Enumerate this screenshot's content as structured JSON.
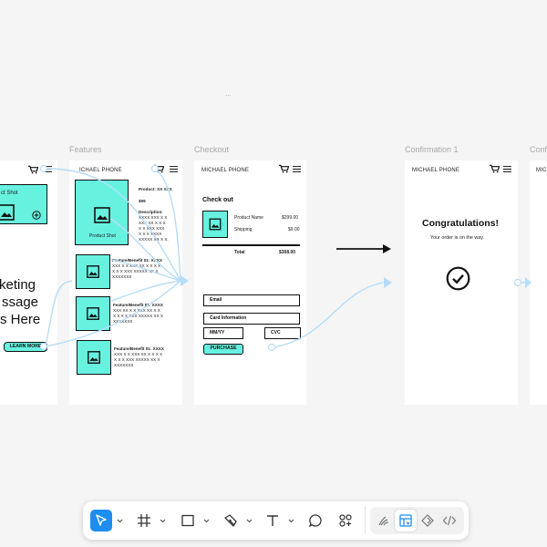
{
  "canvas": {
    "ellipsis": "...",
    "frames": {
      "features_label": "Features",
      "checkout_label": "Checkout",
      "confirmation_label": "Confirmation 1",
      "conf_partial_label": "Conf"
    }
  },
  "home": {
    "product_shot": "ct Shot",
    "marketing_lines": [
      "keting",
      "ssage",
      "s Here"
    ],
    "learn_more": "LEARN MORE"
  },
  "features": {
    "brand": "ICHAEL PHONE",
    "product_shot": "Product Shot",
    "product_label": "Product: XX XXX",
    "price": "$99",
    "description_title": "Description:",
    "description_lines": [
      "XXXX XXX X X",
      "XXX XX X X X",
      "X X XXX XXX",
      "X X X XXXX",
      "XXXXX XX X X."
    ],
    "items": [
      {
        "title": "Feature/Benefit 01: XXXX",
        "lines": [
          "XXX X X XXX XX X X X X",
          "X X X XXX XXXXX XX X",
          "XXXXXXX"
        ]
      },
      {
        "title": "Feature/Benefit 01: XXXX",
        "lines": [
          "XXX XX X X XXX XX X X",
          "X X X X XXX XXXXX XX X",
          "XXXXXXX"
        ]
      },
      {
        "title": "Feature/Benefit 01: XXXX",
        "lines": [
          "XXX X X XXX XX X X X X",
          "X X X XXX XXXXX XX X",
          "XXXXXXX"
        ]
      }
    ]
  },
  "checkout": {
    "brand": "MICHAEL PHONE",
    "title": "Check out",
    "product_name_label": "Product Name",
    "product_price": "$299.00",
    "shipping_label": "Shipping",
    "shipping_price": "$9.00",
    "total_label": "Total",
    "total_value": "$308.00",
    "email_placeholder": "Email",
    "card_placeholder": "Card Information",
    "mmyy_placeholder": "MM/YY",
    "cvc_placeholder": "CVC",
    "purchase_label": "PURCHASE"
  },
  "confirmation": {
    "brand": "MICHAEL PHONE",
    "title": "Congratulations!",
    "subtitle": "Your order is on the way."
  },
  "partial": {
    "brand": "MIC"
  },
  "toolbar": {
    "tools": [
      "move-tool",
      "frame-tool",
      "shape-tool",
      "pen-tool",
      "text-tool",
      "comment-tool",
      "components-tool"
    ],
    "modes": [
      "draw-mode",
      "design-mode",
      "prototype-mode",
      "dev-mode"
    ],
    "accent": "#1e8df2"
  },
  "colors": {
    "teal": "#67f2e0",
    "wire": "#b6dcf8"
  }
}
